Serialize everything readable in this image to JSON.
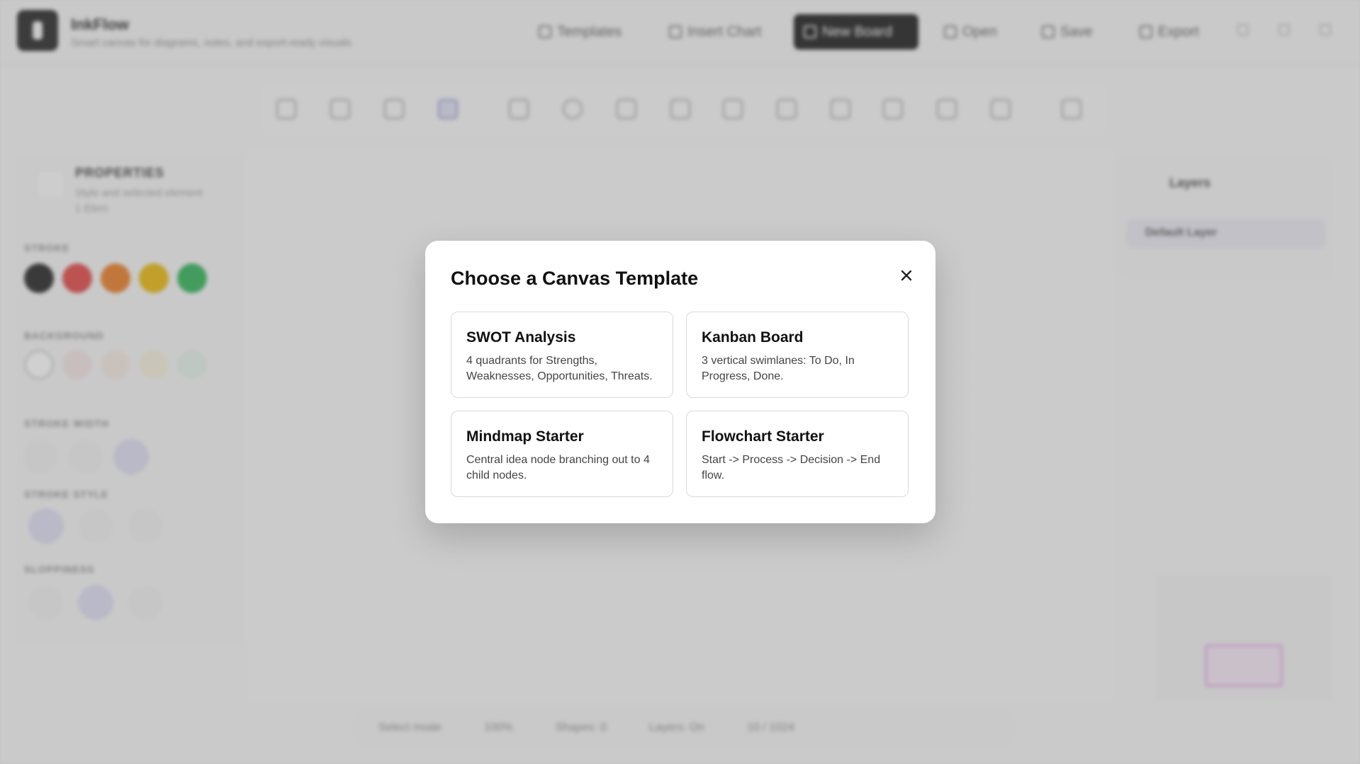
{
  "app": {
    "name": "InkFlow",
    "subtitle": "Smart canvas for diagrams, notes, and export-ready visuals"
  },
  "header": {
    "buttons": [
      {
        "label": "Templates",
        "icon": "template-icon"
      },
      {
        "label": "Insert Chart",
        "icon": "chart-icon"
      },
      {
        "label": "New Board",
        "icon": "plus-icon"
      },
      {
        "label": "Open",
        "icon": "folder-icon"
      },
      {
        "label": "Save",
        "icon": "save-icon"
      },
      {
        "label": "Export",
        "icon": "export-icon"
      }
    ]
  },
  "left_panel": {
    "title": "PROPERTIES",
    "subtitle": "Style and selected element",
    "subtitle2": "1 Elem",
    "sections": {
      "stroke": "STROKE",
      "background": "BACKGROUND",
      "stroke_width": "STROKE WIDTH",
      "stroke_style": "STROKE STYLE",
      "sloppiness": "SLOPPINESS"
    },
    "stroke_colors": [
      "#1a1a1a",
      "#e03e3e",
      "#e8761c",
      "#e8b400",
      "#27ae4f"
    ]
  },
  "layers_panel": {
    "title": "Layers",
    "default_layer": "Default Layer"
  },
  "status_bar": {
    "items": [
      "Select mode",
      "100%",
      "Shapes: 0",
      "Layers: On",
      "10 / 1024"
    ]
  },
  "modal": {
    "title": "Choose a Canvas Template",
    "close_icon": "close-icon",
    "templates": [
      {
        "title": "SWOT Analysis",
        "description": "4 quadrants for Strengths, Weaknesses, Opportunities, Threats."
      },
      {
        "title": "Kanban Board",
        "description": "3 vertical swimlanes: To Do, In Progress, Done."
      },
      {
        "title": "Mindmap Starter",
        "description": "Central idea node branching out to 4 child nodes."
      },
      {
        "title": "Flowchart Starter",
        "description": "Start -> Process -> Decision -> End flow."
      }
    ]
  }
}
